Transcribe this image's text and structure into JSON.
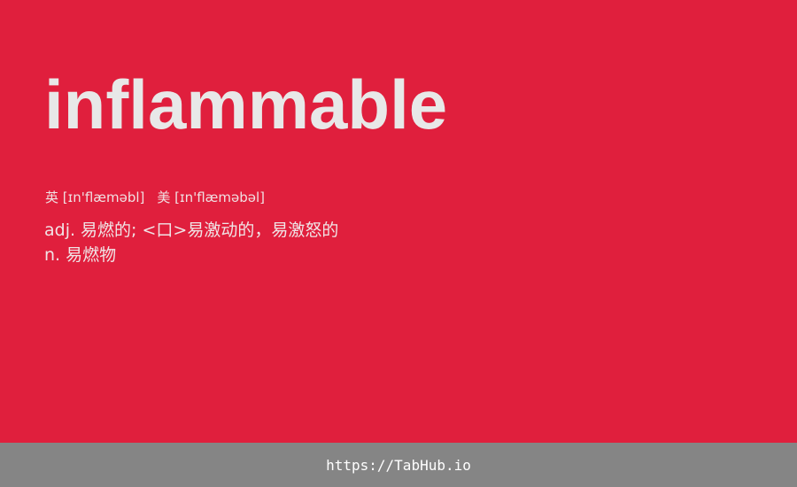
{
  "word": "inflammable",
  "phonetics": {
    "uk": "英 [ɪn'flæməbl]",
    "us": "美 [ɪn'flæməbəl]"
  },
  "definitions": [
    "adj. 易燃的; <口>易激动的，易激怒的",
    "n. 易燃物"
  ],
  "footer": {
    "link": "https://TabHub.io"
  },
  "colors": {
    "background": "#e01f3d",
    "footer": "#858585"
  }
}
